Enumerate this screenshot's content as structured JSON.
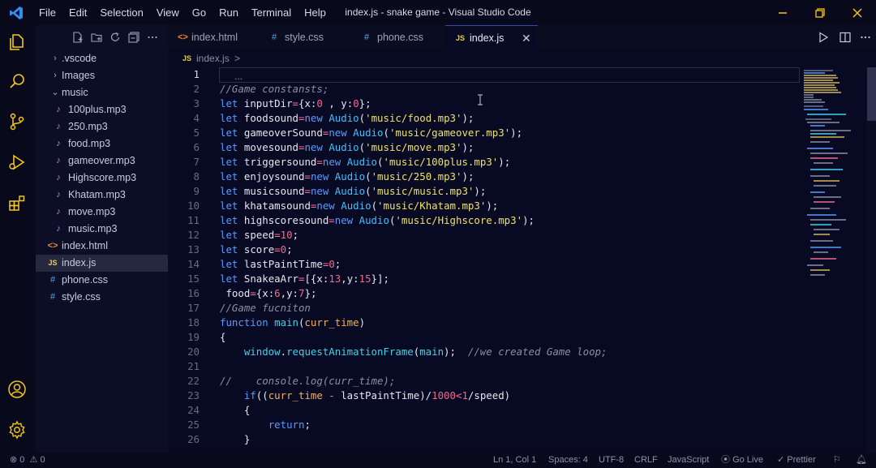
{
  "titlebar": {
    "menu": [
      "File",
      "Edit",
      "Selection",
      "View",
      "Go",
      "Run",
      "Terminal",
      "Help"
    ],
    "window_title": "index.js - snake game - Visual Studio Code"
  },
  "activitybar": {
    "icons": [
      "explorer-icon",
      "search-icon",
      "source-control-icon",
      "run-debug-icon",
      "extensions-icon",
      "account-icon",
      "settings-gear-icon"
    ]
  },
  "explorer": {
    "items": [
      {
        "label": ".vscode",
        "type": "folder-collapsed"
      },
      {
        "label": "Images",
        "type": "folder-collapsed"
      },
      {
        "label": "music",
        "type": "folder-expanded"
      },
      {
        "label": "100plus.mp3",
        "type": "audio"
      },
      {
        "label": "250.mp3",
        "type": "audio"
      },
      {
        "label": "food.mp3",
        "type": "audio"
      },
      {
        "label": "gameover.mp3",
        "type": "audio"
      },
      {
        "label": "Highscore.mp3",
        "type": "audio"
      },
      {
        "label": "Khatam.mp3",
        "type": "audio"
      },
      {
        "label": "move.mp3",
        "type": "audio"
      },
      {
        "label": "music.mp3",
        "type": "audio"
      },
      {
        "label": "index.html",
        "type": "html"
      },
      {
        "label": "index.js",
        "type": "js",
        "active": true
      },
      {
        "label": "phone.css",
        "type": "css"
      },
      {
        "label": "style.css",
        "type": "css"
      }
    ]
  },
  "tabs": [
    {
      "label": "index.html",
      "icon": "<>"
    },
    {
      "label": "style.css",
      "icon": "#"
    },
    {
      "label": "phone.css",
      "icon": "#"
    },
    {
      "label": "index.js",
      "icon": "JS",
      "active": true
    }
  ],
  "breadcrumb": {
    "icon": "JS",
    "file": "index.js",
    "rest": "> ..."
  },
  "code": {
    "line_numbers": [
      "1",
      "2",
      "3",
      "4",
      "5",
      "6",
      "7",
      "8",
      "9",
      "10",
      "11",
      "12",
      "13",
      "14",
      "15",
      "16",
      "17",
      "18",
      "19",
      "20",
      "21",
      "22",
      "23",
      "24",
      "25",
      "26"
    ],
    "l2": "//Game constansts;",
    "l3": [
      "let",
      "inputDir",
      "=",
      "{x:",
      "0",
      " , y:",
      "0",
      "};"
    ],
    "sounds": [
      {
        "var": "foodsound",
        "path": "'music/food.mp3'"
      },
      {
        "var": "gameoverSound",
        "path": "'music/gameover.mp3'"
      },
      {
        "var": "movesound",
        "path": "'music/move.mp3'"
      },
      {
        "var": "triggersound",
        "path": "'music/100plus.mp3'"
      },
      {
        "var": "enjoysound",
        "path": "'music/250.mp3'"
      },
      {
        "var": "musicsound",
        "path": "'music/music.mp3'"
      },
      {
        "var": "khatamsound",
        "path": "'music/Khatam.mp3'"
      },
      {
        "var": "highscoresound",
        "path": "'music/Highscore.mp3'"
      }
    ],
    "kw_let": "let",
    "kw_new": "new",
    "cls_audio": "Audio",
    "eq": "=",
    "open": "(",
    "close": ");",
    "l12": {
      "name": "speed",
      "value": "10"
    },
    "l13": {
      "name": "score",
      "value": "0"
    },
    "l14": {
      "name": "lastPaintTime",
      "value": "0"
    },
    "l15": {
      "a": "SnakeaArr",
      "b": "[{x:",
      "c": "13",
      ",y:": ",y:",
      "d": "15",
      "e": "}];"
    },
    "l16": {
      "a": " food",
      "b": "{x:",
      "c": "6",
      "d": ",y:",
      "e": "7",
      "f": "};"
    },
    "l17": "//Game fucniton",
    "l18": {
      "kw": "function",
      "fn": "main",
      "p": "curr_time"
    },
    "l19": "{",
    "l20": {
      "obj": "window",
      "m": "requestAnimationFrame",
      "arg": "main",
      "cmt": "//we created Game loop;"
    },
    "l22": "//    console.log(curr_time);",
    "l23": {
      "kw": "if",
      "a": "((",
      "p": "curr_time",
      "b": " - ",
      "c": "lastPaintTime",
      "d": ")/",
      "n1": "1000",
      "e": "<",
      "n2": "1",
      "f": "/speed)"
    },
    "l24": "{",
    "l25": {
      "kw": "return",
      "semi": ";"
    },
    "l26": "}"
  },
  "statusbar": {
    "errors": "0",
    "warnings": "0",
    "position": "Ln 1, Col 1",
    "spaces": "Spaces: 4",
    "encoding": "UTF-8",
    "eol": "CRLF",
    "language": "JavaScript",
    "golive": "Go Live",
    "prettier": "Prettier"
  },
  "colors": {
    "accent": "#3a8df5",
    "keyword": "#5a9bff",
    "string": "#f0e16a",
    "number": "#f06a8a",
    "operator": "#ff6aa6"
  }
}
